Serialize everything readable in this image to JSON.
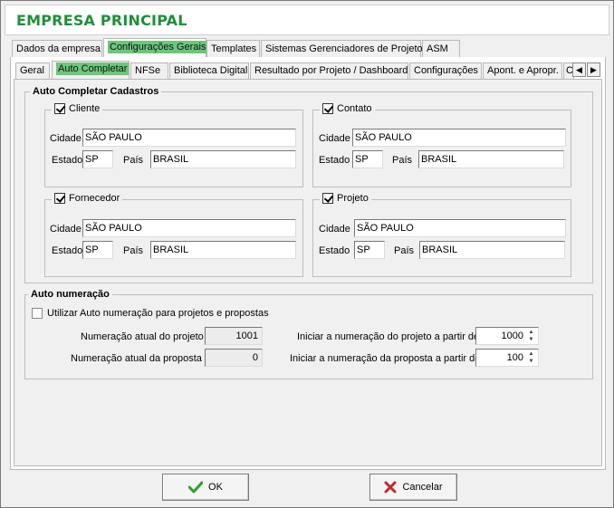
{
  "window": {
    "title": "EMPRESA PRINCIPAL"
  },
  "top_tabs": [
    {
      "label": "Dados da empresa"
    },
    {
      "label": "Configurações Gerais"
    },
    {
      "label": "Templates"
    },
    {
      "label": "Sistemas Gerenciadores de Projeto"
    },
    {
      "label": "ASM"
    }
  ],
  "sub_tabs": [
    {
      "label": "Geral"
    },
    {
      "label": "Auto Completar"
    },
    {
      "label": "NFSe"
    },
    {
      "label": "Biblioteca Digital"
    },
    {
      "label": "Resultado por Projeto / Dashboard"
    },
    {
      "label": "Configurações"
    },
    {
      "label": "Apont. e Apropr."
    },
    {
      "label": "C"
    }
  ],
  "auto_completar": {
    "legend": "Auto Completar Cadastros",
    "labels": {
      "cidade": "Cidade",
      "estado": "Estado",
      "pais": "País"
    },
    "groups": [
      {
        "name": "Cliente",
        "checked": true,
        "cidade": "SÃO PAULO",
        "estado": "SP",
        "pais": "BRASIL"
      },
      {
        "name": "Contato",
        "checked": true,
        "cidade": "SÃO PAULO",
        "estado": "SP",
        "pais": "BRASIL"
      },
      {
        "name": "Fornecedor",
        "checked": true,
        "cidade": "SÃO PAULO",
        "estado": "SP",
        "pais": "BRASIL"
      },
      {
        "name": "Projeto",
        "checked": true,
        "cidade": "SÃO PAULO",
        "estado": "SP",
        "pais": "BRASIL"
      }
    ]
  },
  "auto_numeracao": {
    "legend": "Auto numeração",
    "checkbox_label": "Utilizar Auto numeração para projetos e propostas",
    "checkbox_checked": false,
    "numeracao_projeto_label": "Numeração atual do projeto",
    "numeracao_projeto_value": "1001",
    "numeracao_proposta_label": "Numeração atual da  proposta",
    "numeracao_proposta_value": "0",
    "iniciar_projeto_label": "Iniciar a numeração do projeto a partir de",
    "iniciar_projeto_value": "1000",
    "iniciar_proposta_label": "Iniciar a numeração da proposta a partir de",
    "iniciar_proposta_value": "100"
  },
  "buttons": {
    "ok": "OK",
    "cancel": "Cancelar"
  },
  "colors": {
    "title_green": "#1f8f3a",
    "tab_highlight": "#6cc77a",
    "ok_icon": "#2e9e2e",
    "cancel_icon": "#c0282a"
  },
  "icons": {
    "ok": "check-icon",
    "cancel": "x-icon",
    "scroll_left": "arrow-left-icon",
    "scroll_right": "arrow-right-icon"
  }
}
